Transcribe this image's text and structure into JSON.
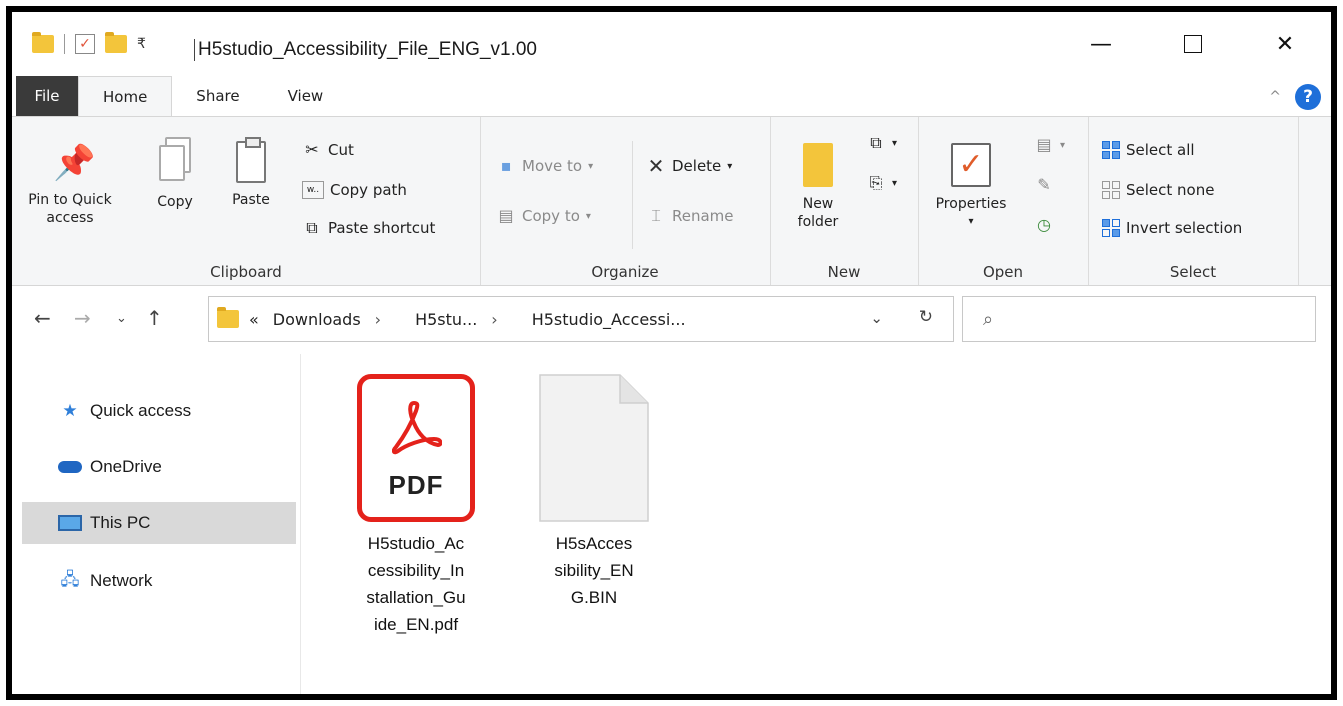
{
  "window": {
    "title": "H5studio_Accessibility_File_ENG_v1.00",
    "minimize_icon": "minimize-icon",
    "maximize_icon": "maximize-icon",
    "close_icon": "close-icon"
  },
  "ribbon_tabs": [
    "File",
    "Home",
    "Share",
    "View"
  ],
  "clipboard": {
    "label": "Clipboard",
    "pin": "Pin to Quick access",
    "pin_l1": "Pin to Quick",
    "pin_l2": "access",
    "copy": "Copy",
    "paste": "Paste",
    "cut": "Cut",
    "copy_path": "Copy path",
    "paste_shortcut": "Paste shortcut"
  },
  "organize": {
    "label": "Organize",
    "move_to": "Move to",
    "copy_to": "Copy to",
    "delete": "Delete",
    "rename": "Rename"
  },
  "new": {
    "label": "New",
    "new_folder_l1": "New",
    "new_folder_l2": "folder"
  },
  "open": {
    "label": "Open",
    "properties": "Properties"
  },
  "select": {
    "label": "Select",
    "select_all": "Select all",
    "select_none": "Select none",
    "invert": "Invert selection"
  },
  "address": {
    "overflow": "«",
    "crumbs": [
      "Downloads",
      "H5stu...",
      "H5studio_Accessi..."
    ]
  },
  "search": {
    "placeholder": ""
  },
  "nav": {
    "items": [
      "Quick access",
      "OneDrive",
      "This PC",
      "Network"
    ],
    "selected": "This PC"
  },
  "files": [
    {
      "name_lines": [
        "H5studio_Ac",
        "cessibility_In",
        "stallation_Gu",
        "ide_EN.pdf"
      ],
      "icon": "pdf-icon",
      "icon_label": "PDF"
    },
    {
      "name_lines": [
        "H5sAcces",
        "sibility_EN",
        "G.BIN"
      ],
      "icon": "blank-file-icon"
    }
  ],
  "colors": {
    "pdf_red": "#e4221b",
    "accent_blue": "#1e6fd9",
    "folder_yellow": "#f3c53b"
  }
}
